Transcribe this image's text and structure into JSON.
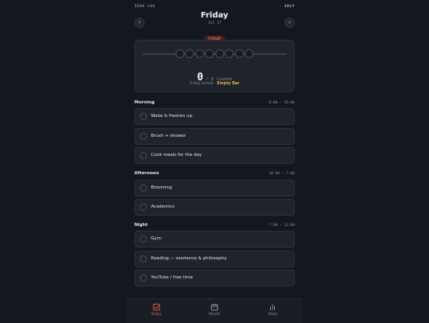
{
  "header": {
    "brand": "IRON LOG",
    "month": "· JULY",
    "day_name": "Friday",
    "date": "Jul 17",
    "today_badge": "TODAY",
    "prev_icon": "chevron-left-icon",
    "next_icon": "chevron-right-icon"
  },
  "progress": {
    "loaded": "0",
    "of_text": "/ 8 loaded",
    "plates_total": 8,
    "plates_loaded": 0,
    "streak_text": "0-day streak · ",
    "streak_status": "Empty Bar"
  },
  "sections": {
    "morning": {
      "title": "Morning",
      "time": "6:00 – 10:00",
      "tasks": [
        "Wake & freshen up",
        "Brush + shower",
        "Cook meals for the day"
      ]
    },
    "afternoon": {
      "title": "Afternoon",
      "time": "10:00 – 7:00",
      "tasks": [
        "Brooming",
        "Academics"
      ]
    },
    "night": {
      "title": "Night",
      "time": "7:00 – 12:00",
      "tasks": [
        "Gym",
        "Reading — existence & philosophy",
        "YouTube / free time"
      ]
    }
  },
  "tabs": [
    {
      "label": "Today",
      "icon": "checkbox-icon",
      "active": true
    },
    {
      "label": "Month",
      "icon": "calendar-icon",
      "active": false
    },
    {
      "label": "Stats",
      "icon": "bar-chart-icon",
      "active": false
    }
  ],
  "colors": {
    "accent": "#e8654f",
    "streak": "#e8b63e",
    "background": "#14171d",
    "card": "#1f232b"
  }
}
